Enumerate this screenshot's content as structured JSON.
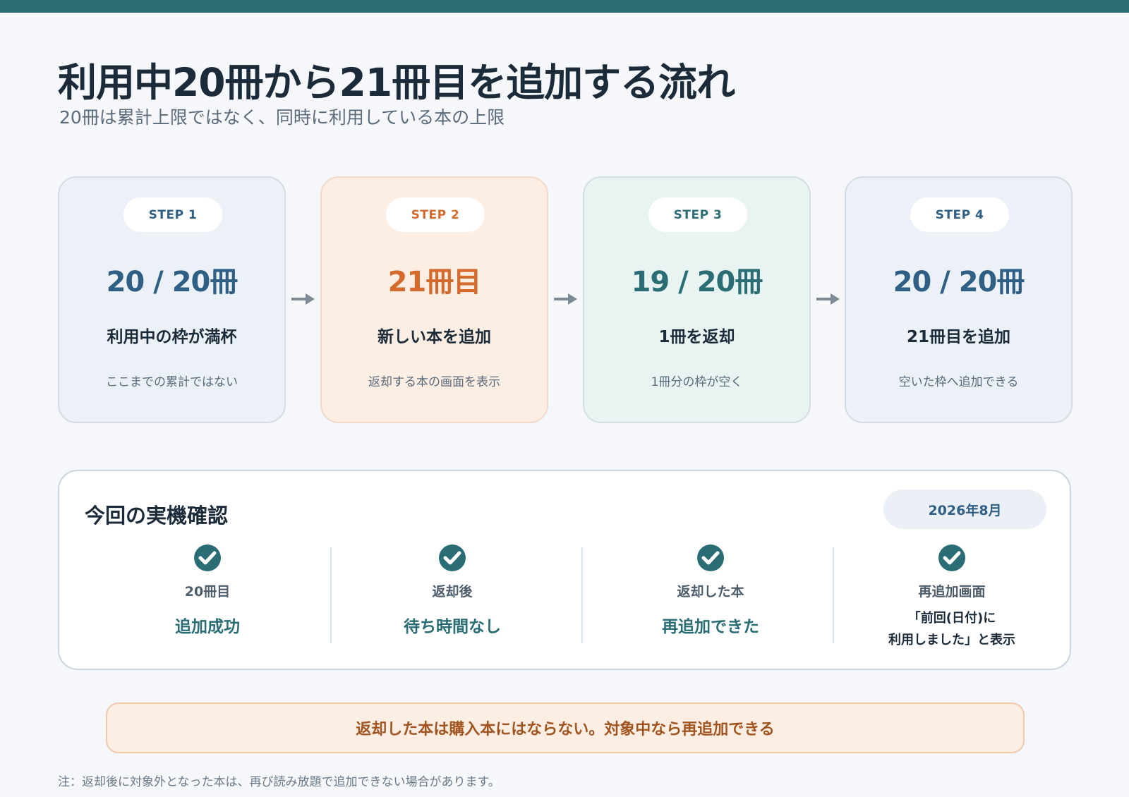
{
  "header": {
    "title": "利用中20冊から21冊目を追加する流れ",
    "subtitle": "20冊は累計上限ではなく、同時に利用している本の上限"
  },
  "steps": [
    {
      "label": "STEP 1",
      "big": "20 / 20冊",
      "heading": "利用中の枠が満杯",
      "desc": "ここまでの累計ではない"
    },
    {
      "label": "STEP 2",
      "big": "21冊目",
      "heading": "新しい本を追加",
      "desc": "返却する本の画面を表示"
    },
    {
      "label": "STEP 3",
      "big": "19 / 20冊",
      "heading": "1冊を返却",
      "desc": "1冊分の枠が空く"
    },
    {
      "label": "STEP 4",
      "big": "20 / 20冊",
      "heading": "21冊目を追加",
      "desc": "空いた枠へ追加できる"
    }
  ],
  "verification": {
    "title": "今回の実機確認",
    "date": "2026年8月",
    "items": [
      {
        "icon": "check-circle-icon",
        "label": "20冊目",
        "value": "追加成功"
      },
      {
        "icon": "check-circle-icon",
        "label": "返却後",
        "value": "待ち時間なし"
      },
      {
        "icon": "check-circle-icon",
        "label": "返却した本",
        "value": "再追加できた"
      },
      {
        "icon": "check-circle-icon",
        "label": "再追加画面",
        "value_line1": "「前回(日付)に",
        "value_line2": "利用しました」と表示"
      }
    ]
  },
  "callout": "返却した本は購入本にはならない。対象中なら再追加できる",
  "footnote": "注：返却後に対象外となった本は、再び読み放題で追加できない場合があります。",
  "colors": {
    "header_bar": "#2a6d74",
    "blue": "#2f5f85",
    "orange": "#d46a2c",
    "teal": "#2a6d74",
    "callout_text": "#a05420"
  }
}
